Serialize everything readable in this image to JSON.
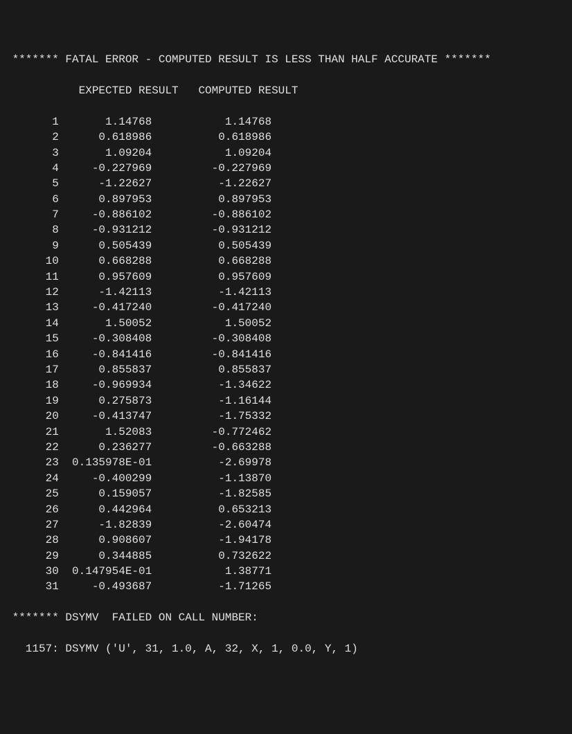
{
  "header": {
    "title": " ******* FATAL ERROR - COMPUTED RESULT IS LESS THAN HALF ACCURATE *******",
    "columns": "           EXPECTED RESULT   COMPUTED RESULT"
  },
  "rows": [
    {
      "idx": "       1",
      "expected": "       1.14768     ",
      "computed": "      1.14768"
    },
    {
      "idx": "       2",
      "expected": "      0.618986     ",
      "computed": "     0.618986"
    },
    {
      "idx": "       3",
      "expected": "       1.09204     ",
      "computed": "      1.09204"
    },
    {
      "idx": "       4",
      "expected": "     -0.227969     ",
      "computed": "    -0.227969"
    },
    {
      "idx": "       5",
      "expected": "      -1.22627     ",
      "computed": "     -1.22627"
    },
    {
      "idx": "       6",
      "expected": "      0.897953     ",
      "computed": "     0.897953"
    },
    {
      "idx": "       7",
      "expected": "     -0.886102     ",
      "computed": "    -0.886102"
    },
    {
      "idx": "       8",
      "expected": "     -0.931212     ",
      "computed": "    -0.931212"
    },
    {
      "idx": "       9",
      "expected": "      0.505439     ",
      "computed": "     0.505439"
    },
    {
      "idx": "      10",
      "expected": "      0.668288     ",
      "computed": "     0.668288"
    },
    {
      "idx": "      11",
      "expected": "      0.957609     ",
      "computed": "     0.957609"
    },
    {
      "idx": "      12",
      "expected": "      -1.42113     ",
      "computed": "     -1.42113"
    },
    {
      "idx": "      13",
      "expected": "     -0.417240     ",
      "computed": "    -0.417240"
    },
    {
      "idx": "      14",
      "expected": "       1.50052     ",
      "computed": "      1.50052"
    },
    {
      "idx": "      15",
      "expected": "     -0.308408     ",
      "computed": "    -0.308408"
    },
    {
      "idx": "      16",
      "expected": "     -0.841416     ",
      "computed": "    -0.841416"
    },
    {
      "idx": "      17",
      "expected": "      0.855837     ",
      "computed": "     0.855837"
    },
    {
      "idx": "      18",
      "expected": "     -0.969934     ",
      "computed": "     -1.34622"
    },
    {
      "idx": "      19",
      "expected": "      0.275873     ",
      "computed": "     -1.16144"
    },
    {
      "idx": "      20",
      "expected": "     -0.413747     ",
      "computed": "     -1.75332"
    },
    {
      "idx": "      21",
      "expected": "       1.52083     ",
      "computed": "    -0.772462"
    },
    {
      "idx": "      22",
      "expected": "      0.236277     ",
      "computed": "    -0.663288"
    },
    {
      "idx": "      23",
      "expected": "  0.135978E-01     ",
      "computed": "     -2.69978"
    },
    {
      "idx": "      24",
      "expected": "     -0.400299     ",
      "computed": "     -1.13870"
    },
    {
      "idx": "      25",
      "expected": "      0.159057     ",
      "computed": "     -1.82585"
    },
    {
      "idx": "      26",
      "expected": "      0.442964     ",
      "computed": "     0.653213"
    },
    {
      "idx": "      27",
      "expected": "      -1.82839     ",
      "computed": "     -2.60474"
    },
    {
      "idx": "      28",
      "expected": "      0.908607     ",
      "computed": "     -1.94178"
    },
    {
      "idx": "      29",
      "expected": "      0.344885     ",
      "computed": "     0.732622"
    },
    {
      "idx": "      30",
      "expected": "  0.147954E-01     ",
      "computed": "      1.38771"
    },
    {
      "idx": "      31",
      "expected": "     -0.493687     ",
      "computed": "     -1.71265"
    }
  ],
  "footer": {
    "line1": " ******* DSYMV  FAILED ON CALL NUMBER:",
    "line2": "   1157: DSYMV ('U', 31, 1.0, A, 32, X, 1, 0.0, Y, 1)"
  }
}
